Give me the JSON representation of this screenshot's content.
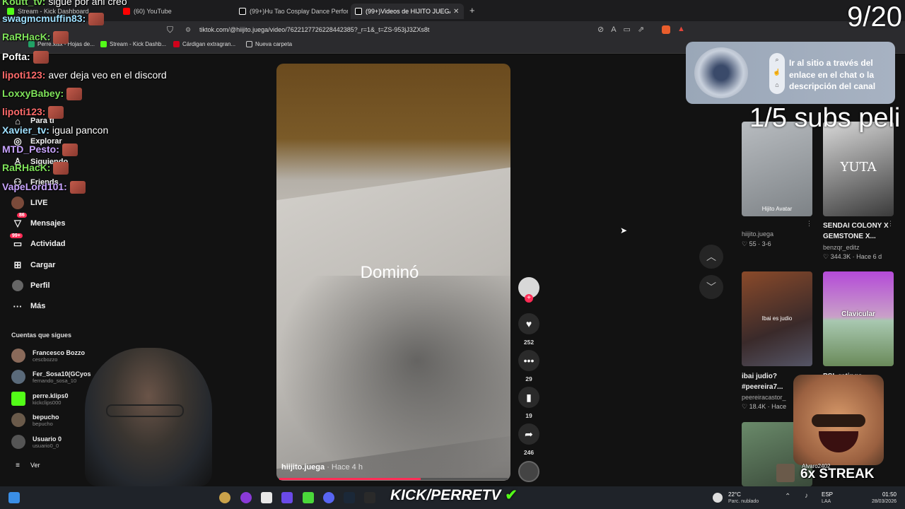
{
  "browser": {
    "tabs": [
      {
        "label": "Stream - Kick Dashboard",
        "color": "#53fc18"
      },
      {
        "label": "(60) YouTube",
        "color": "#ff0000"
      },
      {
        "label": "(99+)Hu Tao Cosplay Dance Perform",
        "color": "#ffffff"
      },
      {
        "label": "(99+)Videos de HIJITO JUEGA",
        "color": "#ffffff"
      }
    ],
    "new_tab_label": "+",
    "url": "tiktok.com/@hiijito.juega/video/7622127726228442385?_r=1&_t=ZS-953jJ3ZXs8t",
    "bookmarks": [
      {
        "label": "Perre.xlsx - Hojas de...",
        "color": "#21a366"
      },
      {
        "label": "Stream - Kick Dashb...",
        "color": "#53fc18"
      },
      {
        "label": "Cárdigan extragran...",
        "color": "#d0021b"
      },
      {
        "label": "Nueva carpeta",
        "color": "#cccccc"
      }
    ]
  },
  "sidebar": {
    "items": [
      {
        "label": "Para ti",
        "icon": "home-icon"
      },
      {
        "label": "Explorar",
        "icon": "compass-icon"
      },
      {
        "label": "Siguiendo",
        "icon": "following-icon"
      },
      {
        "label": "Friends",
        "icon": "friends-icon"
      },
      {
        "label": "LIVE",
        "icon": "live-icon"
      },
      {
        "label": "Mensajes",
        "icon": "messages-icon",
        "badge": "86"
      },
      {
        "label": "Actividad",
        "icon": "activity-icon",
        "badge": "99+"
      },
      {
        "label": "Cargar",
        "icon": "upload-icon"
      },
      {
        "label": "Perfil",
        "icon": "profile-icon"
      },
      {
        "label": "Más",
        "icon": "more-icon"
      }
    ],
    "following_title": "Cuentas que sigues",
    "following": [
      {
        "name": "Francesco Bozzo",
        "handle": "cescbozzo"
      },
      {
        "name": "Fer_Sosa10(GCyos",
        "handle": "fernando_sosa_10"
      },
      {
        "name": "perre.klips0",
        "handle": "kickclips000"
      },
      {
        "name": "bepucho",
        "handle": "bepucho"
      },
      {
        "name": "Usuario 0",
        "handle": "usuario0_0"
      }
    ],
    "see_more": "Ver"
  },
  "video": {
    "overlay_text": "Dominó",
    "author": "hiijito.juega",
    "time": "· Hace 4 h",
    "progress": 0.62,
    "actions": {
      "likes": "252",
      "comments": "29",
      "saves": "19",
      "shares": "246"
    }
  },
  "recommendations": [
    {
      "thumb_label": "Hijito Avatar",
      "title": "",
      "author": "hiijito.juega",
      "stats": "♡ 55 · 3-6"
    },
    {
      "thumb_label": "YUTA",
      "title": "SENDAI COLONY X GEMSTONE X...",
      "author": "benzqr_editz",
      "stats": "♡ 344.3K · Hace 6 d"
    },
    {
      "thumb_label": "Ibai es judio",
      "title": "ibai judio? #peereira7...",
      "author": "peereiracastor_",
      "stats": "♡ 18.4K · Hace"
    },
    {
      "thumb_label": "Clavicular",
      "title": "PSL ratings",
      "author": "",
      "stats": ""
    }
  ],
  "ad": {
    "text": "Ir al sitio a través del enlace en el chat o la descripción del canal"
  },
  "stream": {
    "counter": "9/20",
    "subs_goal": "1/5 subs peli",
    "kick_label": "KICK/PERRETV",
    "streak": "6x STREAK",
    "streak_user": "Alvaro2402"
  },
  "chat": [
    {
      "user": "Koutt_tv:",
      "msg": " sigue por ahi creo",
      "color": "#7fe35a"
    },
    {
      "user": "swagmcmuffin83:",
      "msg": "",
      "color": "#9fe0ff"
    },
    {
      "user": "RaRHacK:",
      "msg": "",
      "color": "#7fe35a"
    },
    {
      "user": "Pofta:",
      "msg": "",
      "color": "#ffffff"
    },
    {
      "user": "lipoti123:",
      "msg": " aver deja veo en el discord",
      "color": "#ff6b6b"
    },
    {
      "user": "LoxxyBabey:",
      "msg": "",
      "color": "#7fe35a"
    },
    {
      "user": "lipoti123:",
      "msg": "",
      "color": "#ff6b6b"
    },
    {
      "user": "Xavier_tv:",
      "msg": " igual  pancon",
      "color": "#9fe0ff"
    },
    {
      "user": "MTD_Pesto:",
      "msg": "",
      "color": "#c9a4ff"
    },
    {
      "user": "RaRHacK:",
      "msg": "",
      "color": "#7fe35a"
    },
    {
      "user": "VapeLord101:",
      "msg": "",
      "color": "#c9a4ff"
    }
  ],
  "taskbar": {
    "weather_temp": "22°C",
    "weather_desc": "Parc. nublado",
    "lang": "ESP",
    "lang2": "LAA",
    "time": "01:50",
    "date": "28/03/2026"
  }
}
